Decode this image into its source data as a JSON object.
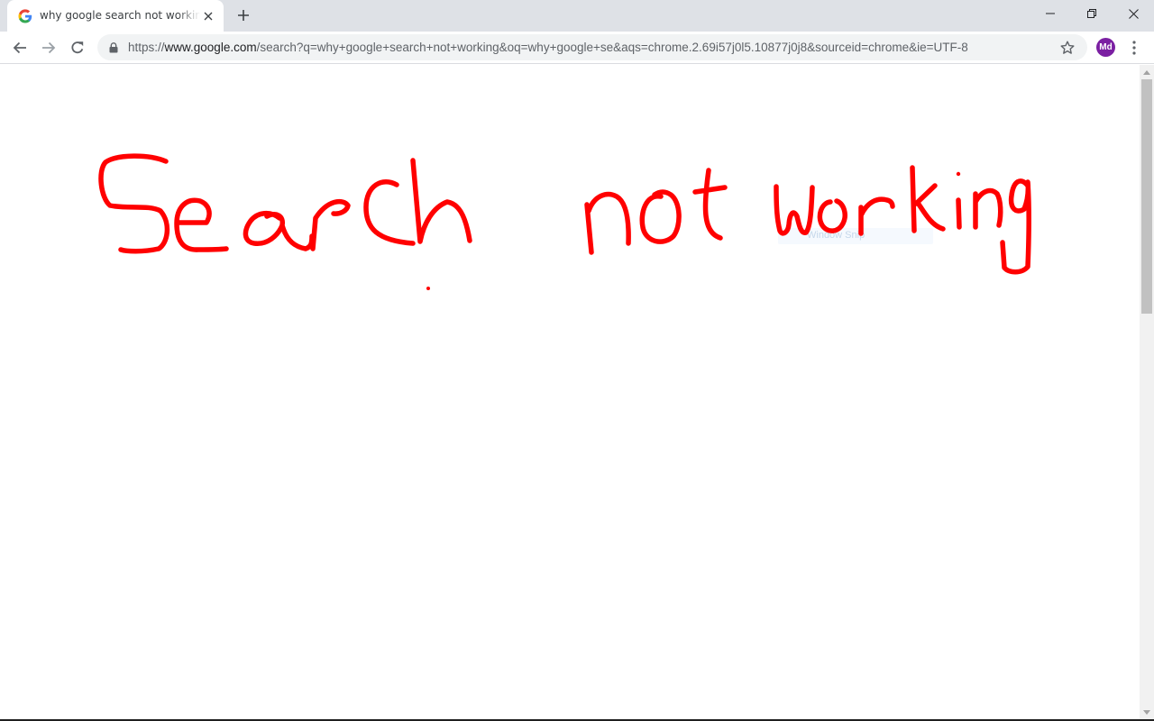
{
  "browser": {
    "tab": {
      "title": "why google search not working - Google Search",
      "close_icon": "close-icon",
      "favicon": "google-g-icon"
    },
    "new_tab_icon": "plus-icon",
    "window_controls": {
      "minimize_icon": "minimize-icon",
      "restore_icon": "restore-icon",
      "close_icon": "close-icon"
    },
    "toolbar": {
      "back_icon": "arrow-left-icon",
      "forward_icon": "arrow-right-icon",
      "reload_icon": "reload-icon",
      "lock_icon": "lock-icon",
      "url_scheme": "https://",
      "url_host": "www.google.com",
      "url_rest": "/search?q=why+google+search+not+working&oq=why+google+se&aqs=chrome.2.69i57j0l5.10877j0j8&sourceid=chrome&ie=UTF-8",
      "bookmark_icon": "star-icon",
      "profile_initials": "Md",
      "profile_color": "#7b1fa2",
      "menu_icon": "more-vert-icon"
    }
  },
  "page": {
    "annotation": {
      "words": [
        "Search",
        "not",
        "working"
      ],
      "ink_color": "#ff0000"
    },
    "ghost_overlay": {
      "label": "Window Snip"
    }
  }
}
